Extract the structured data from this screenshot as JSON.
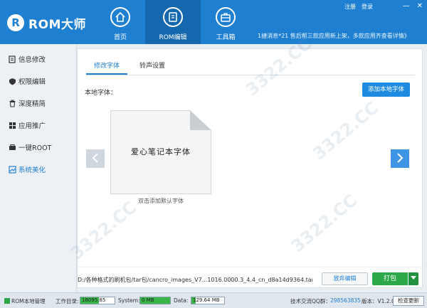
{
  "app": {
    "logo_mark": "R",
    "logo_text": "ROM大师"
  },
  "nav": [
    {
      "label": "首页",
      "icon": "home-icon"
    },
    {
      "label": "ROM编辑",
      "icon": "rom-edit-icon"
    },
    {
      "label": "工具箱",
      "icon": "toolbox-icon"
    }
  ],
  "toplinks": {
    "register": "注册",
    "login": "登录"
  },
  "window": {
    "minimize": "—",
    "close": "✕"
  },
  "marquee": "1捷消息*21 售后帮三款应用新上架，多款应用齐查看详情》",
  "sidebar": [
    {
      "label": "信息修改",
      "icon": "info-edit-icon"
    },
    {
      "label": "权限编辑",
      "icon": "permission-icon"
    },
    {
      "label": "深度精简",
      "icon": "trash-icon"
    },
    {
      "label": "应用推广",
      "icon": "app-grid-icon"
    },
    {
      "label": "一键ROOT",
      "icon": "root-icon"
    },
    {
      "label": "系统美化",
      "icon": "beautify-icon"
    }
  ],
  "tabs": [
    {
      "label": "修改字体"
    },
    {
      "label": "铃声设置"
    }
  ],
  "content": {
    "local_font_label": "本地字体：",
    "add_font_button": "添加本地字体",
    "font_sample": "爱心笔记本字体",
    "font_caption": "双击添加默认字体",
    "file_path": "D:/各种格式的刷机包/tar包/cancro_images_V7...1016.0000.3_4.4_cn_d8a14d9364.tar",
    "discard_button": "放弃编辑",
    "pack_button": "打包"
  },
  "status": {
    "local_manage": "ROM本地管理",
    "workdir_label": "工作目录:",
    "workdir_value": "18095.85 MB",
    "workdir_fill": 0.55,
    "system_label": "System:",
    "system_value": "0 MB",
    "system_fill": 1.0,
    "data_label": "Data:",
    "data_value": "129.64 MB",
    "data_fill": 0.12,
    "qq_label": "技术交流QQ群：",
    "qq_value": "298563835",
    "version": "版本：V1.2.0",
    "update_button": "检查更新"
  },
  "watermark": "3322.CC"
}
